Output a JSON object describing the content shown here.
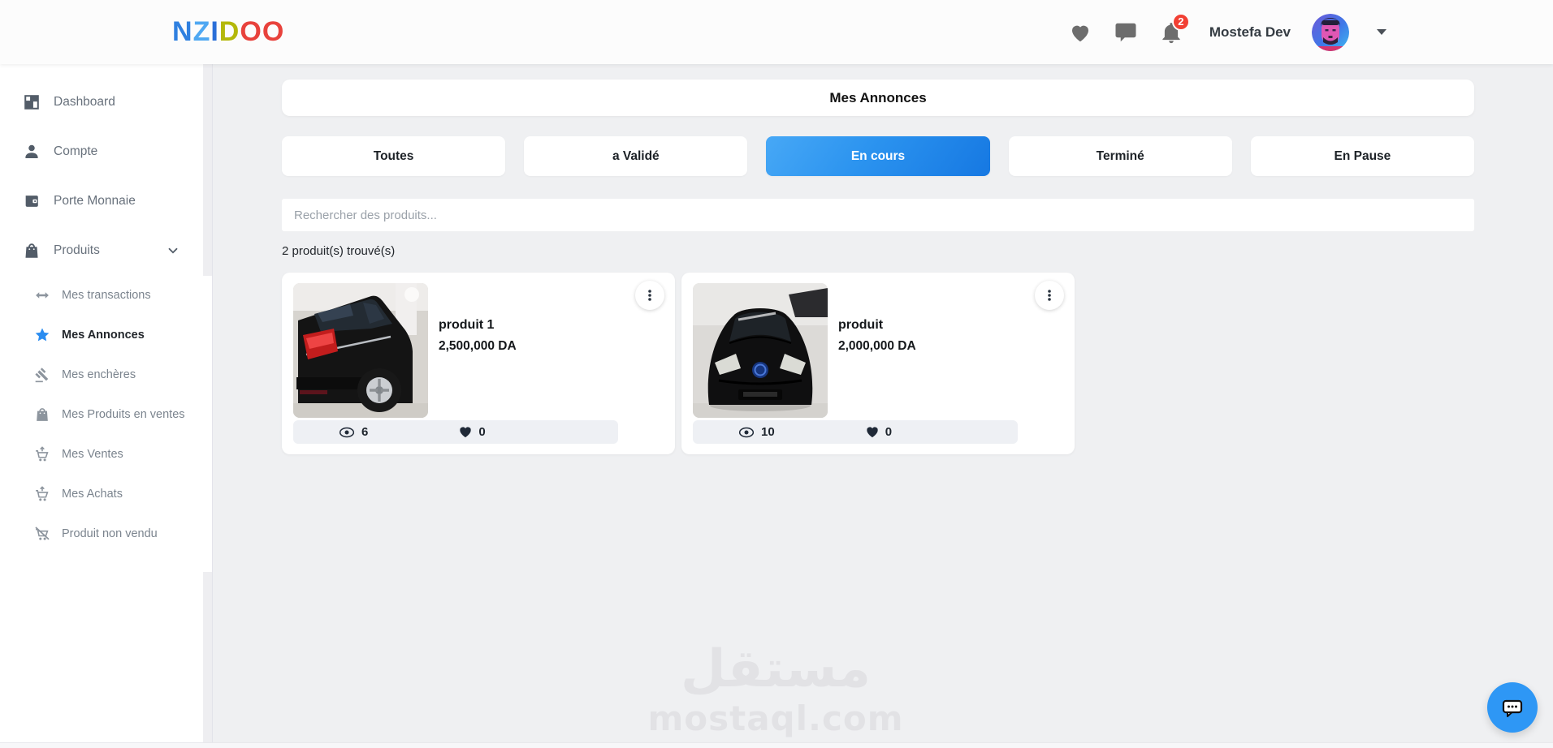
{
  "brand": {
    "logo": [
      {
        "t": "N",
        "color": "#2f80e0"
      },
      {
        "t": "Z",
        "color": "#4fa8f2"
      },
      {
        "t": "I",
        "color": "#2a6fd8"
      },
      {
        "t": "D",
        "color": "#b4b80a"
      },
      {
        "t": "O",
        "color": "#e8423c"
      },
      {
        "t": "O",
        "color": "#e8423c"
      }
    ]
  },
  "header": {
    "user_name": "Mostefa Dev",
    "notification_badge": "2",
    "icons": {
      "favorites": "heart-icon",
      "messages": "chat-icon",
      "notifications": "bell-icon"
    }
  },
  "sidebar": {
    "items": [
      {
        "label": "Dashboard",
        "icon": "dashboard-icon"
      },
      {
        "label": "Compte",
        "icon": "person-icon"
      },
      {
        "label": "Porte Monnaie",
        "icon": "wallet-icon"
      },
      {
        "label": "Produits",
        "icon": "shopping-bag-icon"
      }
    ],
    "submenu": [
      {
        "label": "Mes transactions",
        "icon": "swap-arrows-icon"
      },
      {
        "label": "Mes Annonces",
        "icon": "star-icon",
        "active": true
      },
      {
        "label": "Mes enchères",
        "icon": "gavel-icon"
      },
      {
        "label": "Mes Produits en ventes",
        "icon": "bag-icon"
      },
      {
        "label": "Mes Ventes",
        "icon": "cart-up-icon"
      },
      {
        "label": "Mes Achats",
        "icon": "cart-up-icon"
      },
      {
        "label": "Produit non vendu",
        "icon": "cart-slash-icon"
      }
    ]
  },
  "main": {
    "page_title": "Mes Annonces",
    "tabs": [
      {
        "label": "Toutes"
      },
      {
        "label": "a Validé"
      },
      {
        "label": "En cours",
        "active": true
      },
      {
        "label": "Terminé"
      },
      {
        "label": "En Pause"
      }
    ],
    "search_placeholder": "Rechercher des produits...",
    "results_count": "2 produit(s) trouvé(s)",
    "products": [
      {
        "name": "produit 1",
        "price": "2,500,000 DA",
        "views": "6",
        "likes": "0",
        "image_desc": "black SUV rear view in showroom"
      },
      {
        "name": "produit",
        "price": "2,000,000 DA",
        "views": "10",
        "likes": "0",
        "image_desc": "black hatchback front view"
      }
    ]
  },
  "watermark": {
    "line1": "مستقل",
    "line2": "mostaql.com"
  },
  "colors": {
    "accent_blue": "#2196f3",
    "active_tab_gradient_start": "#47a8f6",
    "active_tab_gradient_end": "#1678e2",
    "badge_red": "#f23f33",
    "background": "#eff0f2",
    "stat_bar": "#eef0f4"
  }
}
